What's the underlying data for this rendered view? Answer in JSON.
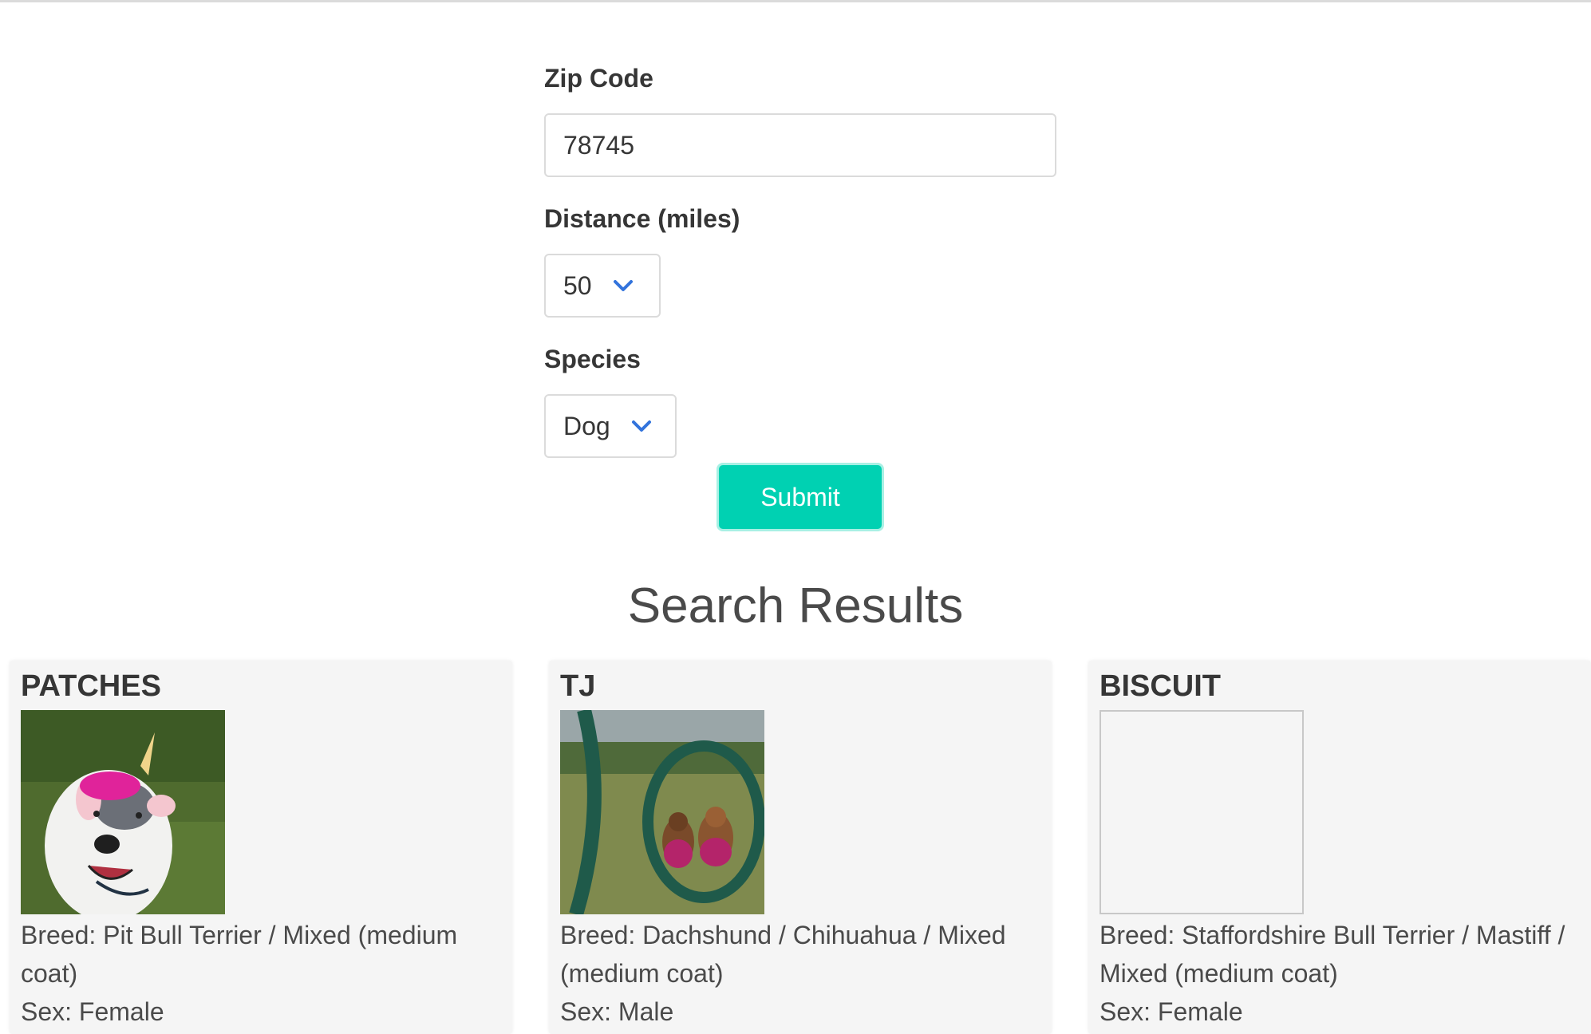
{
  "form": {
    "zip": {
      "label": "Zip Code",
      "value": "78745"
    },
    "distance": {
      "label": "Distance (miles)",
      "value": "50"
    },
    "species": {
      "label": "Species",
      "value": "Dog"
    },
    "submit_label": "Submit"
  },
  "results": {
    "title": "Search Results",
    "pets": [
      {
        "name": "PATCHES",
        "breed": "Breed: Pit Bull Terrier / Mixed (medium coat)",
        "sex": "Sex: Female",
        "photo": "dog-with-unicorn-horn"
      },
      {
        "name": "TJ",
        "breed": "Breed: Dachshund / Chihuahua / Mixed (medium coat)",
        "sex": "Sex: Male",
        "photo": "two-small-dogs-in-park"
      },
      {
        "name": "BISCUIT",
        "breed": "Breed: Staffordshire Bull Terrier / Mastiff / Mixed (medium coat)",
        "sex": "Sex: Female",
        "photo": ""
      }
    ]
  },
  "colors": {
    "primary": "#00d1b2",
    "chevron": "#3273dc",
    "text": "#363636",
    "card_bg": "#f5f5f5"
  },
  "icons": {
    "select_arrow": "chevron-down-icon"
  }
}
